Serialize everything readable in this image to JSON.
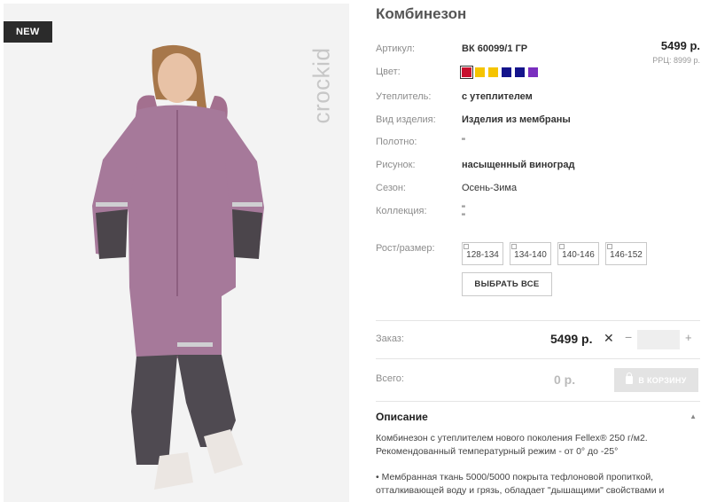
{
  "badge": "NEW",
  "brand": "crockid",
  "product": {
    "title": "Комбинезон",
    "price": "5499 р.",
    "rrp": "РРЦ: 8999 р.",
    "attributes": [
      {
        "label": "Артикул:",
        "value": "ВК 60099/1 ГР"
      },
      {
        "label": "Цвет:",
        "value": ""
      },
      {
        "label": "Утеплитель:",
        "value": "с утеплителем"
      },
      {
        "label": "Вид изделия:",
        "value": "Изделия из мембраны"
      },
      {
        "label": "Полотно:",
        "value": "\""
      },
      {
        "label": "Рисунок:",
        "value": "насыщенный виноград"
      },
      {
        "label": "Сезон:",
        "value": "Осень-Зима"
      },
      {
        "label": "Коллекция:",
        "value": "\"\n\""
      }
    ],
    "colors": [
      "#c8102e",
      "#f5c400",
      "#f5c400",
      "#14148c",
      "#14148c",
      "#7a2fbf"
    ],
    "size_label": "Рост/размер:",
    "sizes": [
      "128-134",
      "134-140",
      "140-146",
      "146-152"
    ],
    "select_all": "ВЫБРАТЬ ВСЕ"
  },
  "order": {
    "label": "Заказ:",
    "price": "5499 р.",
    "x": "✕",
    "minus": "−",
    "plus": "+",
    "qty_value": ""
  },
  "total": {
    "label": "Всего:",
    "value": "0 р.",
    "cart_button": "В КОРЗИНУ"
  },
  "description": {
    "title": "Описание",
    "toggle": "▲",
    "p1": "Комбинезон с утеплителем нового поколения Fellex® 250 г/м2. Рекомендованный температурный режим - от 0° до -25°",
    "p2": "• Мембранная ткань 5000/5000 покрыта тефлоновой пропиткой, отталкивающей воду и грязь, обладает \"дышащими\" свойствами и"
  }
}
